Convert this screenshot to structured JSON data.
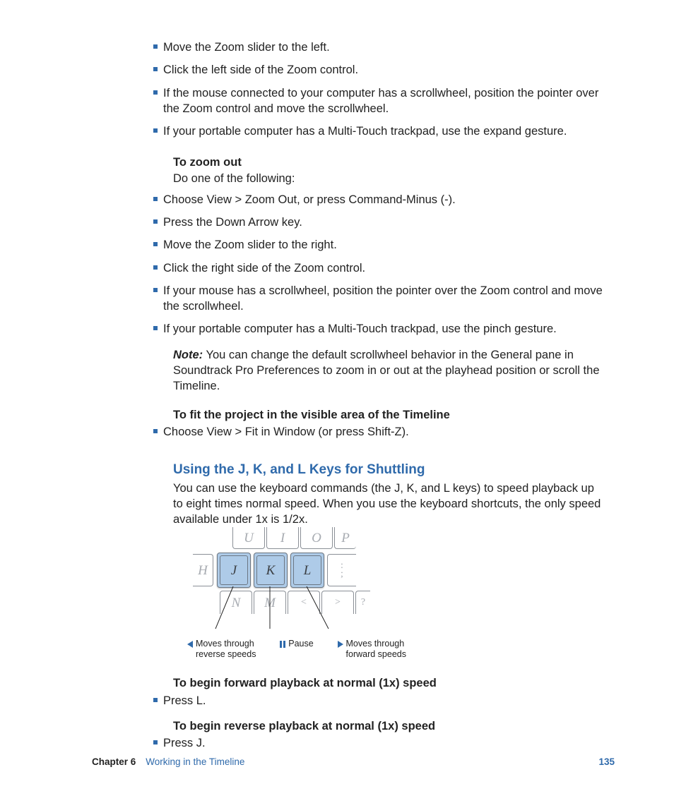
{
  "list1": {
    "items": [
      "Move the Zoom slider to the left.",
      "Click the left side of the Zoom control.",
      "If the mouse connected to your computer has a scrollwheel, position the pointer over the Zoom control and move the scrollwheel.",
      "If your portable computer has a Multi-Touch trackpad, use the expand gesture."
    ]
  },
  "zoom_out": {
    "heading": "To zoom out",
    "intro": "Do one of the following:",
    "items": [
      "Choose View > Zoom Out, or press Command-Minus (-).",
      "Press the Down Arrow key.",
      "Move the Zoom slider to the right.",
      "Click the right side of the Zoom control.",
      "If your mouse has a scrollwheel, position the pointer over the Zoom control and move the scrollwheel.",
      "If your portable computer has a Multi-Touch trackpad, use the pinch gesture."
    ]
  },
  "note": {
    "label": "Note:",
    "text": "You can change the default scrollwheel behavior in the General pane in Soundtrack Pro Preferences to zoom in or out at the playhead position or scroll the Timeline."
  },
  "fit": {
    "heading": "To fit the project in the visible area of the Timeline",
    "item": "Choose View > Fit in Window (or press Shift-Z)."
  },
  "section": {
    "title": "Using the J, K, and L Keys for Shuttling",
    "body": "You can use the keyboard commands (the J, K, and L keys) to speed playback up to eight times normal speed. When you use the keyboard shortcuts, the only speed available under 1x is 1/2x."
  },
  "keyboard": {
    "rows": {
      "top": [
        "U",
        "I",
        "O",
        "P"
      ],
      "mid": [
        "H",
        "J",
        "K",
        "L",
        ";",
        ";"
      ],
      "bot": [
        "N",
        "M",
        "<",
        ">",
        "?"
      ]
    },
    "labels": {
      "left": {
        "l1": "Moves through",
        "l2": "reverse speeds"
      },
      "center": "Pause",
      "right": {
        "l1": "Moves through",
        "l2": "forward speeds"
      }
    }
  },
  "fwd": {
    "heading": "To begin forward playback at normal (1x) speed",
    "item": "Press L."
  },
  "rev": {
    "heading": "To begin reverse playback at normal (1x) speed",
    "item": "Press J."
  },
  "footer": {
    "chapter_label": "Chapter 6",
    "chapter_title": "Working in the Timeline",
    "page": "135"
  }
}
